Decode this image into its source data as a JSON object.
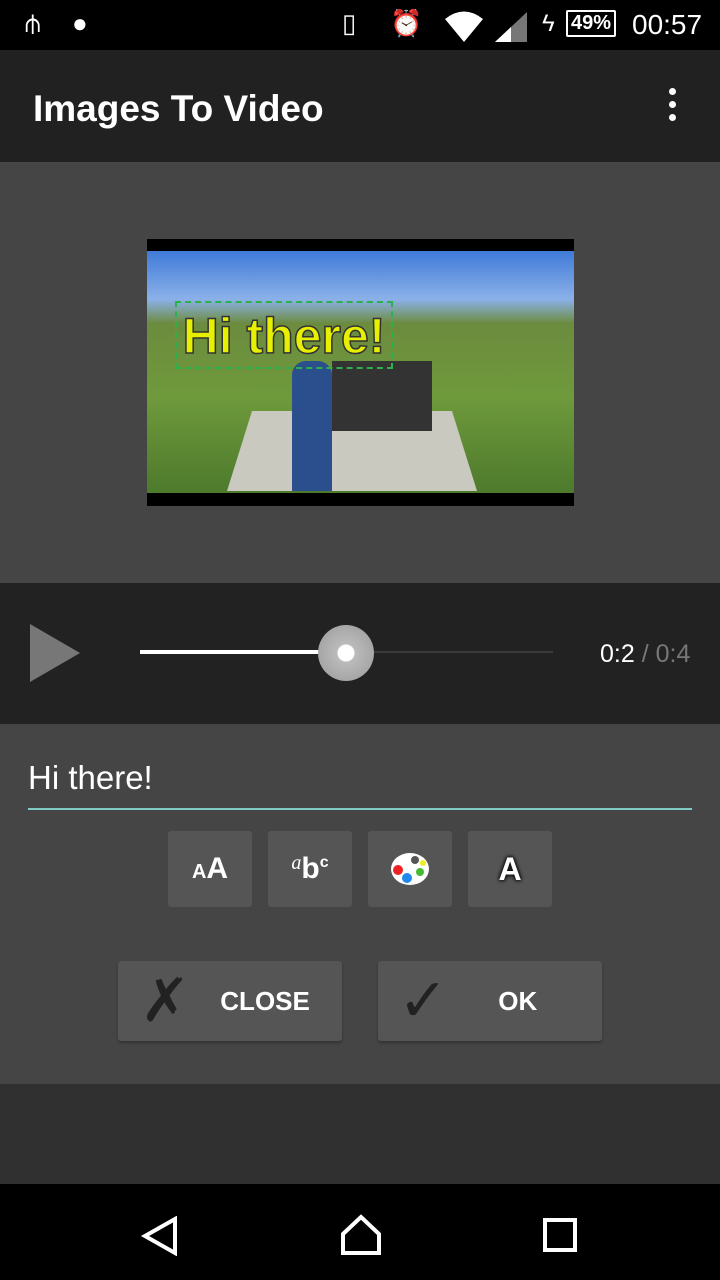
{
  "status_bar": {
    "battery": "49%",
    "time": "00:57",
    "icons": [
      "usb-icon",
      "android-icon",
      "vibrate-icon",
      "alarm-icon",
      "wifi-icon",
      "signal-icon",
      "charging-icon",
      "battery-icon"
    ]
  },
  "app_bar": {
    "title": "Images To Video",
    "menu_icon": "more-vert-icon"
  },
  "preview": {
    "overlay_text": "Hi there!"
  },
  "player": {
    "current_time": "0:2",
    "separator": " / ",
    "total_time": "0:4",
    "progress": 0.5
  },
  "editor": {
    "text_value": "Hi there!",
    "tools": [
      "text-size-icon",
      "font-style-icon",
      "color-palette-icon",
      "text-outline-icon"
    ],
    "close_label": "CLOSE",
    "ok_label": "OK"
  },
  "colors": {
    "accent": "#80cbc4",
    "overlay_text": "#e6f000",
    "overlay_box": "#2bb24c"
  }
}
